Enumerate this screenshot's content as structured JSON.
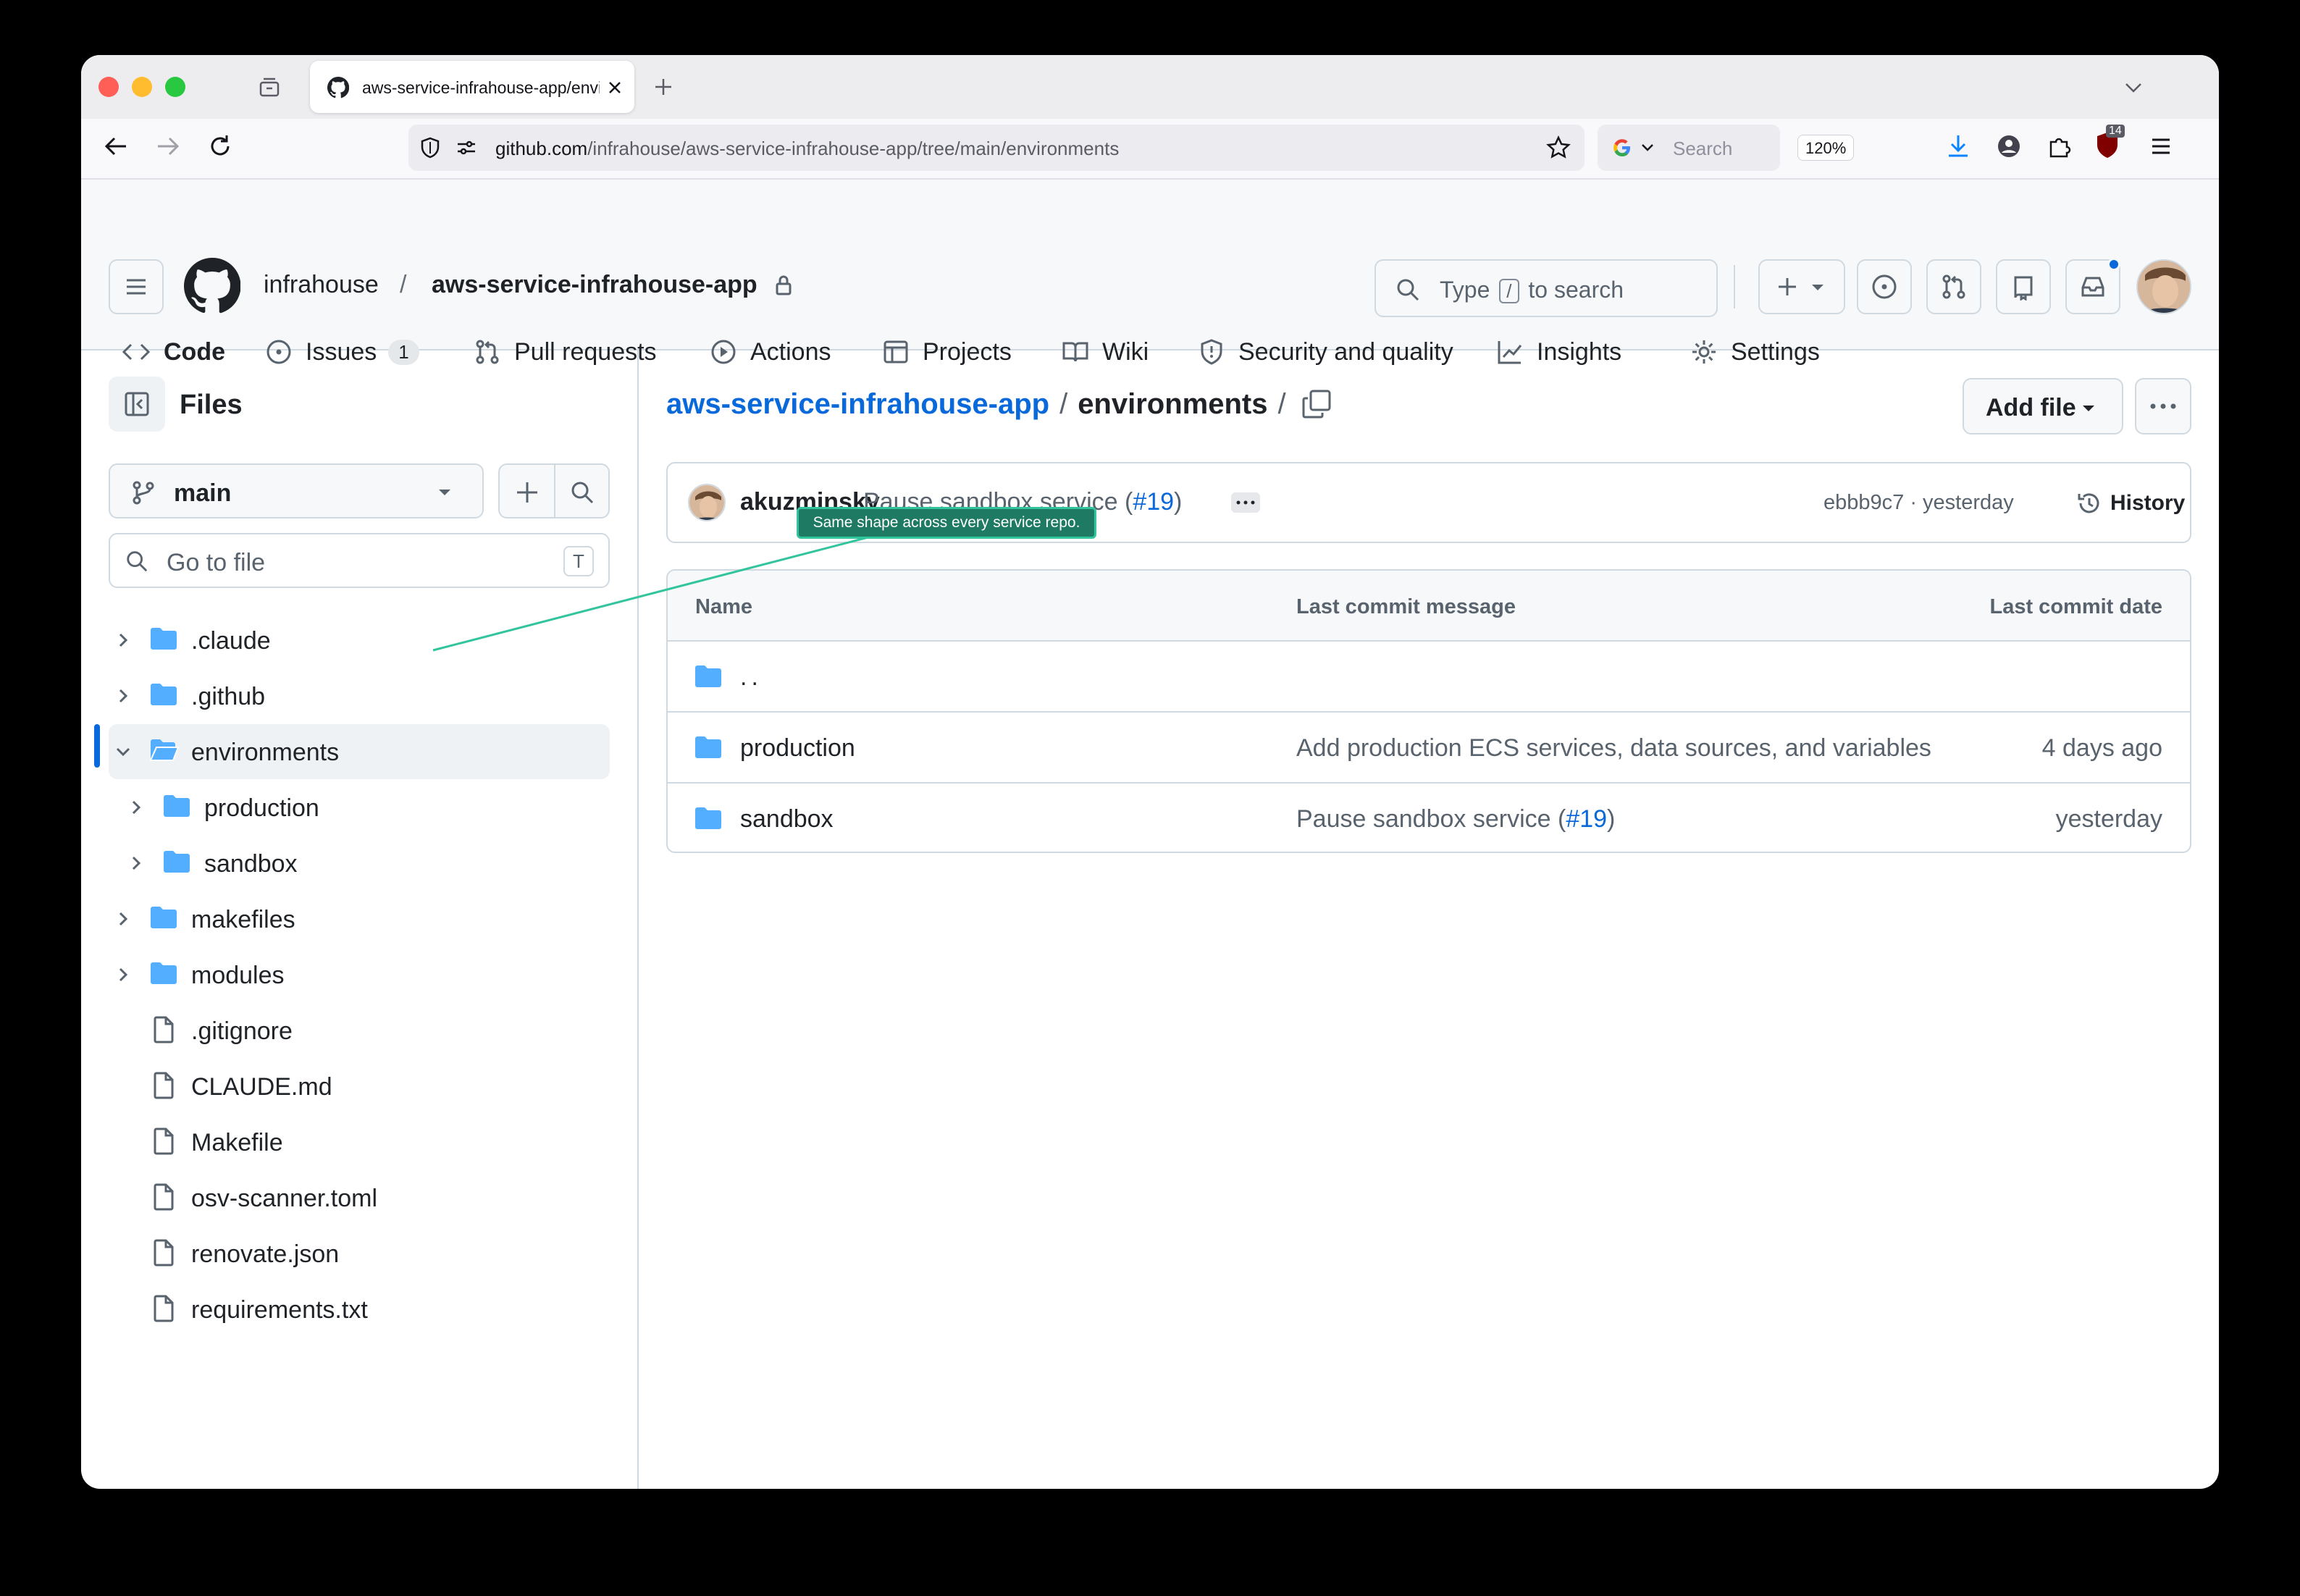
{
  "browser": {
    "tab_title": "aws-service-infrahouse-app/environments",
    "url_host": "github.com",
    "url_path": "/infrahouse/aws-service-infrahouse-app/tree/main/environments",
    "zoom": "120%",
    "search_placeholder": "Search",
    "extension_badge": "14"
  },
  "header": {
    "owner": "infrahouse",
    "separator": "/",
    "repo": "aws-service-infrahouse-app",
    "search_prefix": "Type",
    "search_key": "/",
    "search_suffix": "to search"
  },
  "repo_nav": [
    {
      "label": "Code",
      "icon": "code-icon"
    },
    {
      "label": "Issues",
      "icon": "issue-icon",
      "count": "1"
    },
    {
      "label": "Pull requests",
      "icon": "pull-request-icon"
    },
    {
      "label": "Actions",
      "icon": "play-icon"
    },
    {
      "label": "Projects",
      "icon": "table-icon"
    },
    {
      "label": "Wiki",
      "icon": "book-icon"
    },
    {
      "label": "Security and quality",
      "icon": "shield-icon"
    },
    {
      "label": "Insights",
      "icon": "graph-icon"
    },
    {
      "label": "Settings",
      "icon": "gear-icon"
    }
  ],
  "sidebar": {
    "title": "Files",
    "branch": "main",
    "goto_placeholder": "Go to file",
    "goto_key": "T",
    "tree": [
      {
        "name": ".claude",
        "type": "folder"
      },
      {
        "name": ".github",
        "type": "folder"
      },
      {
        "name": "environments",
        "type": "folder-open"
      },
      {
        "name": "production",
        "type": "folder"
      },
      {
        "name": "sandbox",
        "type": "folder"
      },
      {
        "name": "makefiles",
        "type": "folder"
      },
      {
        "name": "modules",
        "type": "folder"
      },
      {
        "name": ".gitignore",
        "type": "file"
      },
      {
        "name": "CLAUDE.md",
        "type": "file"
      },
      {
        "name": "Makefile",
        "type": "file"
      },
      {
        "name": "osv-scanner.toml",
        "type": "file"
      },
      {
        "name": "renovate.json",
        "type": "file"
      },
      {
        "name": "requirements.txt",
        "type": "file"
      }
    ]
  },
  "main": {
    "breadcrumb_repo": "aws-service-infrahouse-app",
    "breadcrumb_sep": "/",
    "breadcrumb_current": "environments",
    "breadcrumb_trailing": "/",
    "add_file": "Add file",
    "commit": {
      "author": "akuzminsky",
      "message": "Pause sandbox service (",
      "pr": "#19",
      "message_end": ")",
      "sha_time": "ebbb9c7 · yesterday",
      "history": "History"
    },
    "table": {
      "headers": {
        "name": "Name",
        "message": "Last commit message",
        "date": "Last commit date"
      },
      "parent": "..",
      "rows": [
        {
          "name": "production",
          "message": "Add production ECS services, data sources, and variables",
          "date": "4 days ago"
        },
        {
          "name": "sandbox",
          "message": "Pause sandbox service (",
          "pr": "#19",
          "message_end": ")",
          "date": "yesterday"
        }
      ]
    }
  },
  "annotation": {
    "tooltip": "Same shape across every service repo."
  },
  "colors": {
    "accent": "#0969da",
    "folder": "#54aeff",
    "tab_underline": "#fd8c73",
    "annotation": "#32c59d"
  }
}
